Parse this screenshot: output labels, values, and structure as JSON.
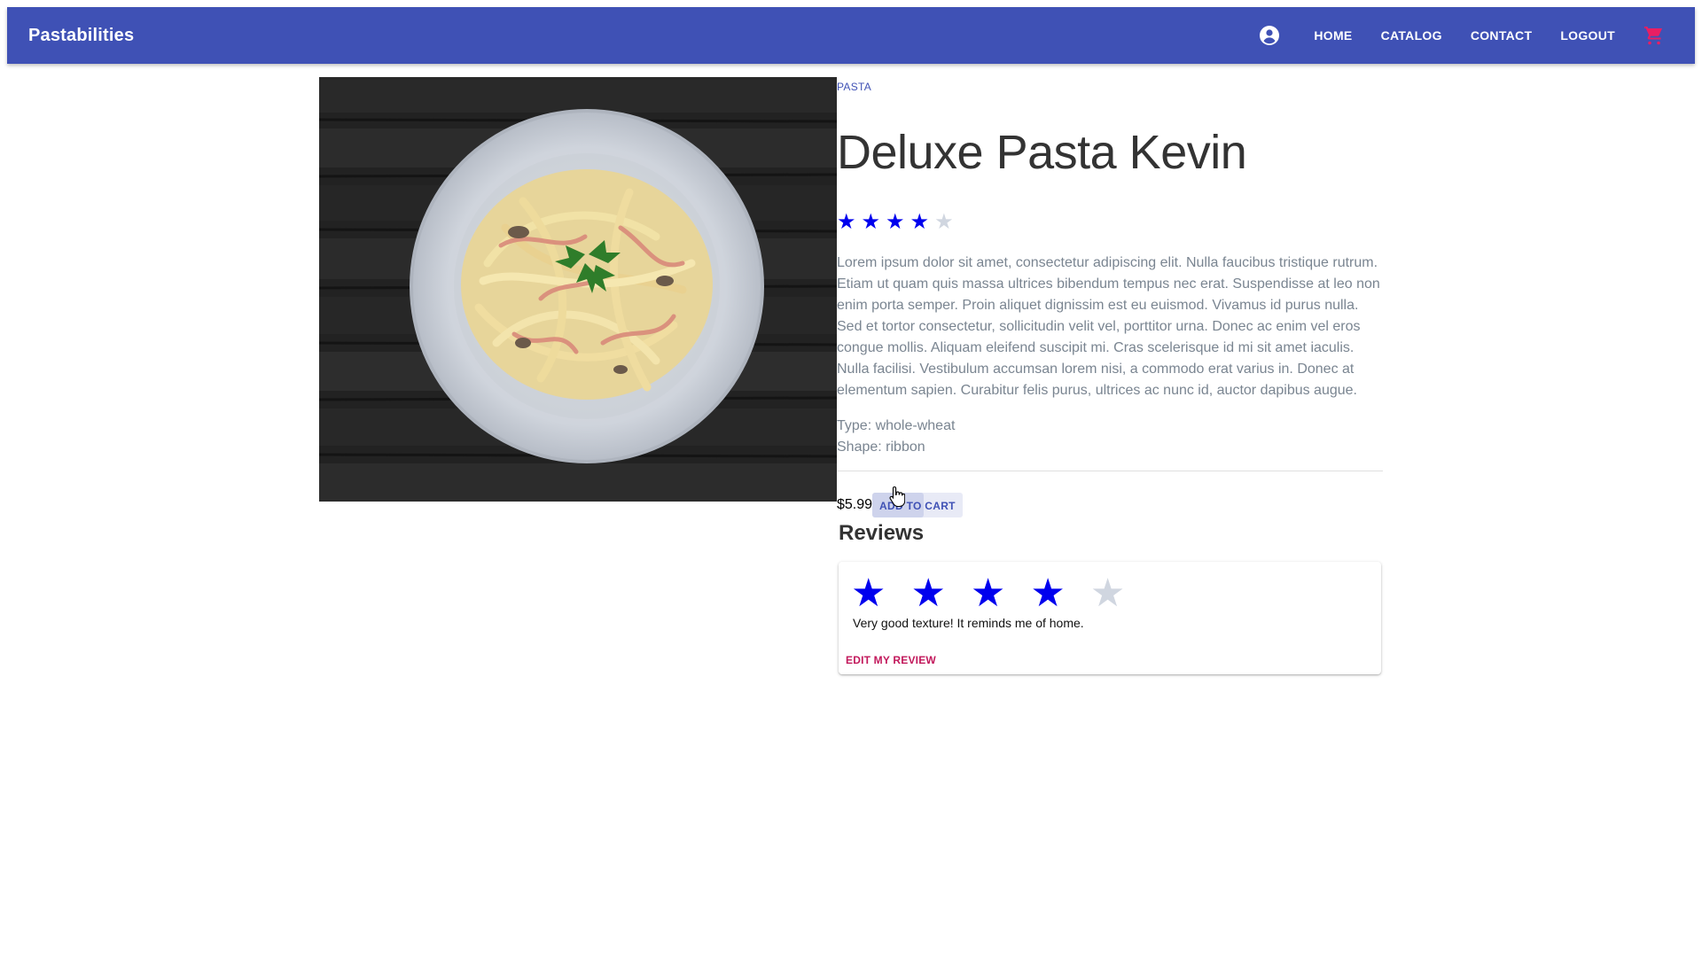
{
  "appbar": {
    "brand": "Pastabilities",
    "account_icon": "account-circle-icon",
    "nav": [
      "HOME",
      "CATALOG",
      "CONTACT",
      "LOGOUT"
    ],
    "cart_icon": "shopping-cart-icon",
    "bar_color": "#3f51b5",
    "cart_color": "#e91e63"
  },
  "product": {
    "category": "PASTA",
    "title": "Deluxe Pasta Kevin",
    "rating": 4,
    "rating_max": 5,
    "description": "Lorem ipsum dolor sit amet, consectetur adipiscing elit. Nulla faucibus tristique rutrum. Etiam ut quam quis massa ultrices bibendum tempus nec erat. Suspendisse at leo non enim porta semper. Proin aliquet dignissim est eu euismod. Vivamus id purus nulla. Sed et tortor consectetur, sollicitudin velit vel, porttitor urna. Donec ac enim vel eros congue mollis. Aliquam eleifend suscipit mi. Cras scelerisque id mi sit amet iaculis. Nulla facilisi. Vestibulum accumsan lorem nisi, a commodo erat varius in. Donec at elementum sapien. Curabitur felis purus, ultrices ac nunc id, auctor dapibus augue.",
    "type": "Type: whole-wheat",
    "shape": "Shape: ribbon",
    "price": "$5.99",
    "add_to_cart": "ADD TO CART"
  },
  "reviews": {
    "heading": "Reviews",
    "items": [
      {
        "rating": 4,
        "rating_max": 5,
        "text": "Very good texture! It reminds me of home.",
        "edit_label": "EDIT MY REVIEW"
      }
    ]
  },
  "colors": {
    "star_on": "#0000ee",
    "star_off": "#d0d6e0",
    "accent_pink": "#c2185b"
  }
}
